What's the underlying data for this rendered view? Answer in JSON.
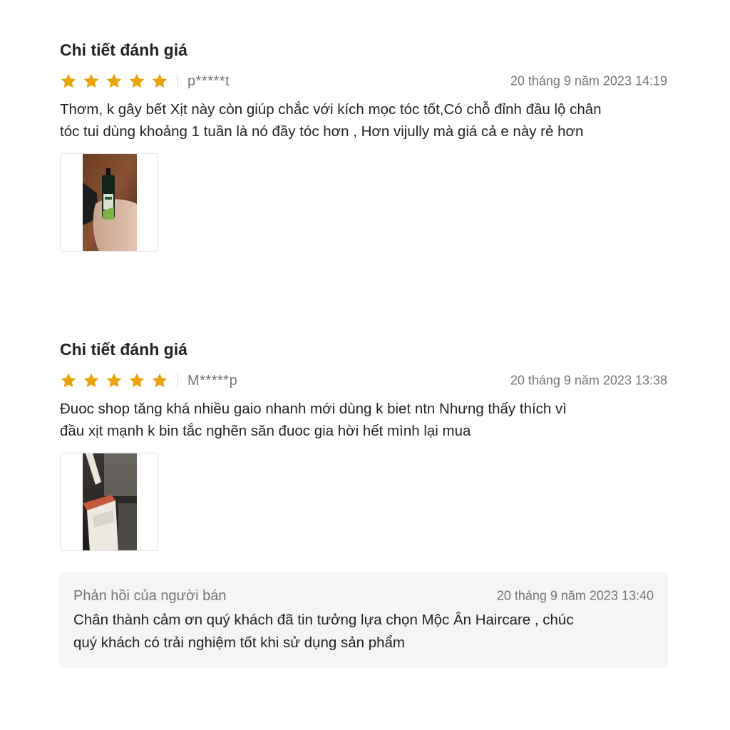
{
  "reviews": [
    {
      "title": "Chi tiết đánh giá",
      "rating": 5,
      "username": "p*****t",
      "date": "20 tháng 9 năm 2023 14:19",
      "comment_line1": "Thơm, k gây bết Xịt này còn giúp chắc với kích mọc tóc tốt,Có chỗ đỉnh đầu lộ chân",
      "comment_line2": "tóc tui dùng khoảng 1 tuần là nó đầy tóc hơn , Hơn vijully mà giá cả e này rẻ hơn",
      "photo": "hand-holding-spray-bottle"
    },
    {
      "title": "Chi tiết đánh giá",
      "rating": 5,
      "username": "M*****p",
      "date": "20 tháng 9 năm 2023 13:38",
      "comment_line1": "Đuoc shop tăng khá nhiều gaio nhanh mới dùng k biet ntn Nhưng thấy thích vì",
      "comment_line2": "đầu xịt mạnh k bin tắc nghẽn săn đuoc gia hời hết mình lại mua",
      "photo": "ceiling-interior"
    }
  ],
  "seller_reply": {
    "label": "Phản hồi của người bán",
    "date": "20 tháng 9 năm 2023 13:40",
    "text_line1": "Chân thành cảm ơn quý khách đã tin tưởng lựa chọn Mộc Ân Haircare , chúc",
    "text_line2": "quý khách có trải nghiệm tốt khi sử dụng sản phẩm"
  },
  "colors": {
    "star": "#E8A30C",
    "muted_text": "#757575",
    "reply_bg": "#F5F5F5"
  },
  "icons": [
    "star-icon"
  ]
}
